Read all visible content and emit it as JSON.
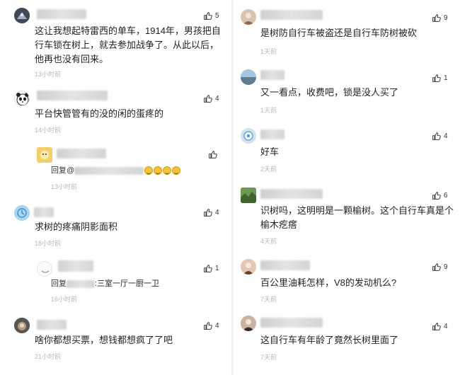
{
  "left_comments": [
    {
      "text": "这让我想起特雷西的单车，1914年，男孩把自行车锁在树上，就去参加战争了。从此以后，他再也没有回来。",
      "time": "13小时前",
      "likes": "5"
    },
    {
      "text": "平台快管管有的没的闲的蛋疼的",
      "time": "14小时前",
      "likes": "4"
    },
    {
      "reply_prefix": "回复@",
      "text": "",
      "time": "13小时前",
      "likes": ""
    },
    {
      "text": "求树的疼痛阴影面积",
      "time": "18小时前",
      "likes": "4"
    },
    {
      "reply_prefix": "回复",
      "text": "三室一厅一厨一卫",
      "time": "16小时前",
      "likes": "1"
    },
    {
      "text": "啥你都想买票，想钱都想疯了了吧",
      "time": "21小时前",
      "likes": "4"
    }
  ],
  "right_comments": [
    {
      "text": "是树防自行车被盗还是自行车防树被砍",
      "time": "1天前",
      "likes": "9"
    },
    {
      "text": "又一看点，收费吧，锁是没人买了",
      "time": "1天前",
      "likes": "1"
    },
    {
      "text": "好车",
      "time": "2天前",
      "likes": "4"
    },
    {
      "text": "识树吗，这明明是一颗榆树。这个自行车真是个榆木疙瘩",
      "time": "4天前",
      "likes": "6"
    },
    {
      "text": "百公里油耗怎样，V8的发动机么?",
      "time": "7天前",
      "likes": "9"
    },
    {
      "text": "这自行车有年龄了竟然长树里面了",
      "time": "7天前",
      "likes": "4"
    }
  ],
  "icons": {
    "like": "thumbs-up-icon",
    "emoji": "laughing-emoji-icon"
  }
}
